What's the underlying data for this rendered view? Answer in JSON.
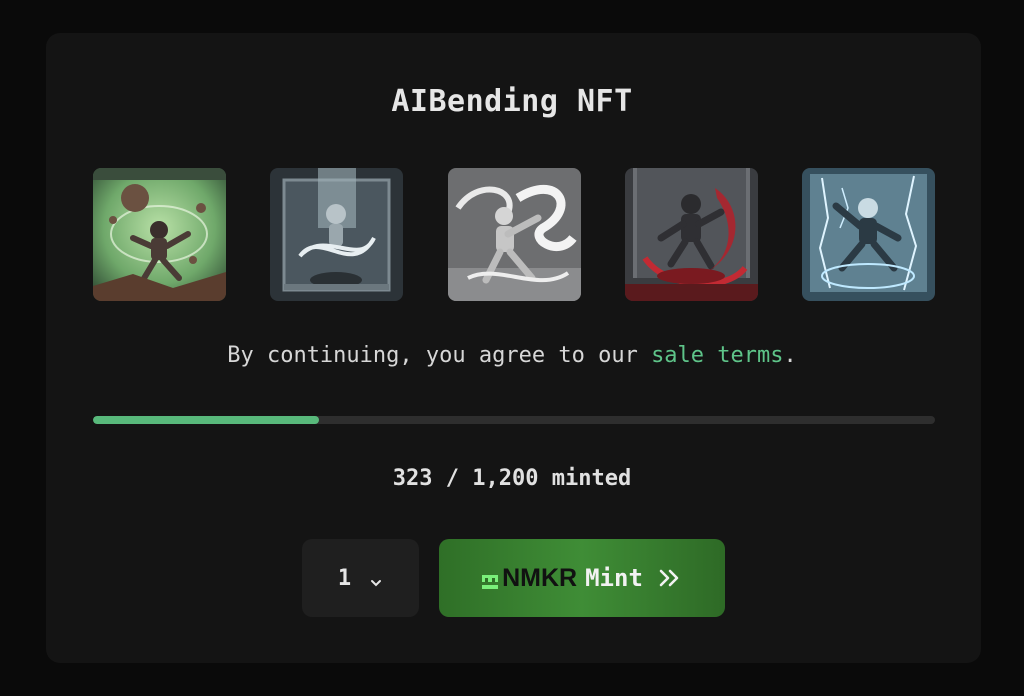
{
  "title": "AIBending NFT",
  "thumbnails": [
    {
      "name": "earth-bender-robot-image",
      "palette": "green"
    },
    {
      "name": "air-bender-robot-chamber-image",
      "palette": "steel"
    },
    {
      "name": "wind-bender-robot-image",
      "palette": "grey"
    },
    {
      "name": "fire-bender-robot-image",
      "palette": "red"
    },
    {
      "name": "lightning-bender-robot-image",
      "palette": "blue"
    }
  ],
  "terms": {
    "prefix": "By continuing, you agree to our ",
    "link_text": "sale terms",
    "suffix": "."
  },
  "progress": {
    "minted": 323,
    "total": 1200,
    "fraction": 0.269,
    "label": "323 / 1,200 minted"
  },
  "quantity": {
    "value": "1"
  },
  "mint_button": {
    "brand": "NMKR",
    "label": "Mint",
    "icon": "double-chevron-right-icon"
  },
  "colors": {
    "accent": "#58b97b",
    "link": "#5ec489",
    "mint_button": "#3f8d36"
  }
}
